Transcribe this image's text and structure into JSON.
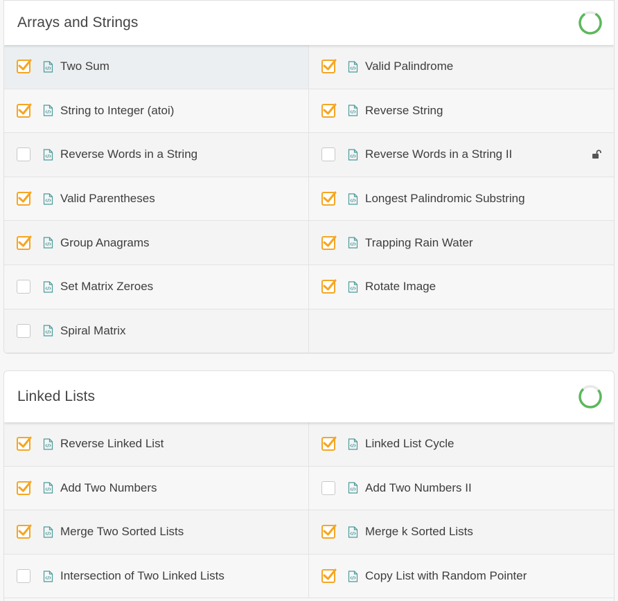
{
  "sections": [
    {
      "title": "Arrays and Strings",
      "progress_color": "#5cb85c",
      "items": [
        {
          "label": "Two Sum",
          "checked": true
        },
        {
          "label": "Valid Palindrome",
          "checked": true
        },
        {
          "label": "String to Integer (atoi)",
          "checked": true
        },
        {
          "label": "Reverse String",
          "checked": true
        },
        {
          "label": "Reverse Words in a String",
          "checked": false
        },
        {
          "label": "Reverse Words in a String II",
          "checked": false,
          "locked": true
        },
        {
          "label": "Valid Parentheses",
          "checked": true
        },
        {
          "label": "Longest Palindromic Substring",
          "checked": true
        },
        {
          "label": "Group Anagrams",
          "checked": true
        },
        {
          "label": "Trapping Rain Water",
          "checked": true
        },
        {
          "label": "Set Matrix Zeroes",
          "checked": false
        },
        {
          "label": "Rotate Image",
          "checked": true
        },
        {
          "label": "Spiral Matrix",
          "checked": false
        }
      ]
    },
    {
      "title": "Linked Lists",
      "progress_color": "#5cb85c",
      "items": [
        {
          "label": "Reverse Linked List",
          "checked": true
        },
        {
          "label": "Linked List Cycle",
          "checked": true
        },
        {
          "label": "Add Two Numbers",
          "checked": true
        },
        {
          "label": "Add Two Numbers II",
          "checked": false
        },
        {
          "label": "Merge Two Sorted Lists",
          "checked": true
        },
        {
          "label": "Merge k Sorted Lists",
          "checked": true
        },
        {
          "label": "Intersection of Two Linked Lists",
          "checked": false
        },
        {
          "label": "Copy List with Random Pointer",
          "checked": true
        }
      ]
    }
  ],
  "colors": {
    "check_accent": "#f5a623",
    "file_icon": "#4a9a9a"
  },
  "icons": {
    "checkbox": "checkbox-icon",
    "file": "code-file-icon",
    "lock": "unlock-icon",
    "progress": "progress-ring-icon"
  }
}
